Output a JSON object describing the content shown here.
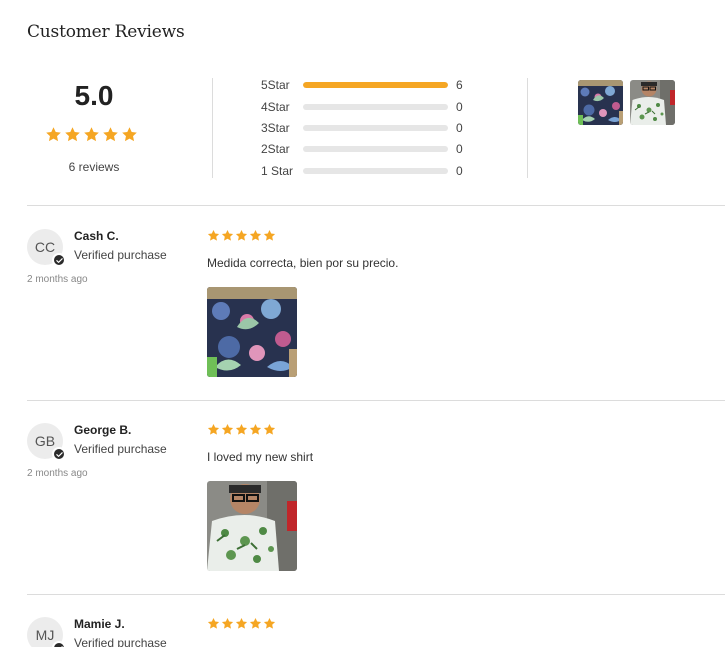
{
  "section": {
    "title": "Customer Reviews"
  },
  "summary": {
    "average": "5.0",
    "review_count": "6 reviews",
    "star_color": "#f5a623",
    "breakdown": [
      {
        "label": "5Star",
        "count": "6",
        "fraction": 1.0
      },
      {
        "label": "4Star",
        "count": "0",
        "fraction": 0
      },
      {
        "label": "3Star",
        "count": "0",
        "fraction": 0
      },
      {
        "label": "2Star",
        "count": "0",
        "fraction": 0
      },
      {
        "label": "1 Star",
        "count": "0",
        "fraction": 0
      }
    ]
  },
  "reviews": [
    {
      "initials": "CC",
      "name": "Cash C.",
      "verified": "Verified purchase",
      "date": "2 months ago",
      "rating": 5,
      "text": "Medida correcta, bien por su precio."
    },
    {
      "initials": "GB",
      "name": "George B.",
      "verified": "Verified purchase",
      "date": "2 months ago",
      "rating": 5,
      "text": "I loved my new shirt"
    },
    {
      "initials": "MJ",
      "name": "Mamie J.",
      "verified": "Verified purchase",
      "date": "",
      "rating": 5,
      "text": ""
    }
  ]
}
